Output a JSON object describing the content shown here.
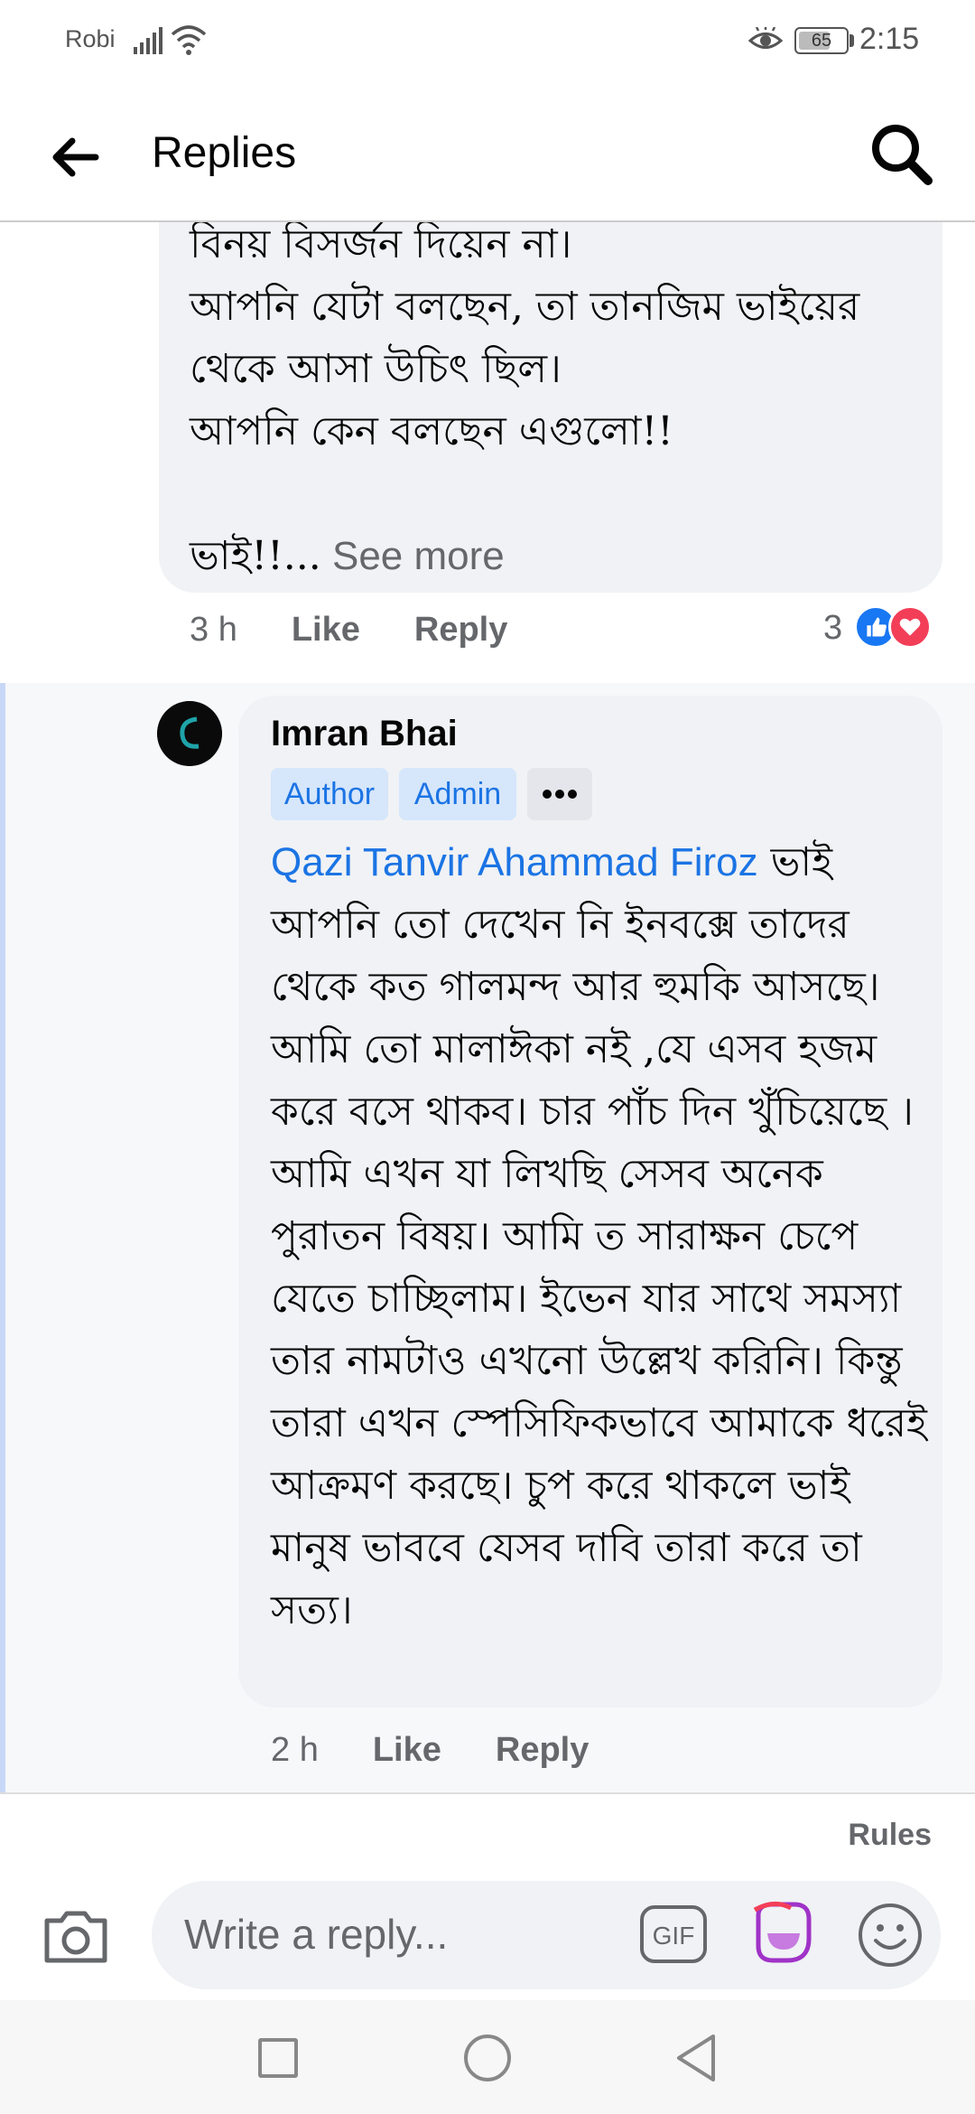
{
  "status_bar": {
    "carrier": "Robi",
    "battery": "65",
    "time": "2:15"
  },
  "header": {
    "title": "Replies"
  },
  "comments": [
    {
      "text_lines": "বিনয় বিসর্জন দিয়েন না।\nআপনি যেটা বলছেন, তা তানজিম ভাইয়ের থেকে আসা উচিৎ ছিল।\nআপনি কেন বলছেন এগুলো!!\n\nভাই!!...",
      "see_more": " See more",
      "time": "3 h",
      "like_label": "Like",
      "reply_label": "Reply",
      "reaction_count": "3"
    },
    {
      "author": "Imran Bhai",
      "badges": [
        "Author",
        "Admin"
      ],
      "mention": "Qazi Tanvir Ahammad Firoz",
      "text": " ভাই আপনি তো দেখেন নি ইনবক্সে তাদের থেকে কত গালমন্দ আর হুমকি আসছে। আমি তো মালাঈকা নই ,যে এসব হজম করে বসে থাকব। চার পাঁচ দিন খুঁচিয়েছে ।  আমি এখন যা লিখছি সেসব অনেক পুরাতন বিষয়। আমি ত সারাক্ষন চেপে যেতে চাচ্ছিলাম। ইভেন যার সাথে সমস্যা তার নামটাও এখনো উল্লেখ করিনি। কিন্তু তারা এখন স্পেসিফিকভাবে আমাকে ধরেই আক্রমণ করছে। চুপ করে থাকলে ভাই মানুষ ভাববে যেসব দাবি তারা করে তা সত্য।",
      "time": "2 h",
      "like_label": "Like",
      "reply_label": "Reply"
    }
  ],
  "composer": {
    "rules_label": "Rules",
    "placeholder": "Write a reply...",
    "gif_label": "GIF"
  },
  "icons": {
    "back": "arrow-left-icon",
    "search": "search-icon",
    "camera": "camera-icon",
    "gif": "gif-icon",
    "sticker": "sticker-icon",
    "emoji": "smiley-icon"
  },
  "colors": {
    "accent": "#1b74e4",
    "bubble": "#f0f2f5",
    "like": "#1877f2",
    "love": "#f33e58",
    "sticker": "#a033c7"
  }
}
